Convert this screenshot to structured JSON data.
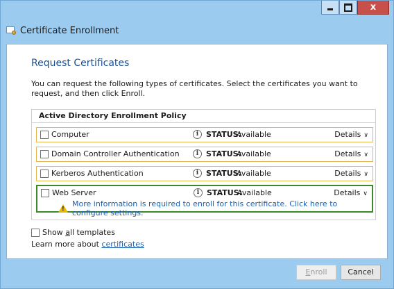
{
  "window": {
    "title": "Certificate Enrollment",
    "caption_buttons": {
      "close": "x"
    }
  },
  "page": {
    "heading": "Request Certificates",
    "intro": "You can request the following types of certificates. Select the certificates you want to request, and then click Enroll."
  },
  "policy": {
    "header": "Active Directory Enrollment Policy",
    "rows": [
      {
        "label": "Computer",
        "status_label": "STATUS:",
        "status": "Available",
        "details": "Details",
        "checked": false
      },
      {
        "label": "Domain Controller Authentication",
        "status_label": "STATUS:",
        "status": "Available",
        "details": "Details",
        "checked": false
      },
      {
        "label": "Kerberos Authentication",
        "status_label": "STATUS:",
        "status": "Available",
        "details": "Details",
        "checked": false
      },
      {
        "label": "Web Server",
        "status_label": "STATUS:",
        "status": "Available",
        "details": "Details",
        "checked": false,
        "warning": "More information is required to enroll for this certificate. Click here to configure settings."
      }
    ]
  },
  "show_all_templates": {
    "prefix": "Show ",
    "accel": "a",
    "suffix": "ll templates",
    "checked": false
  },
  "learn_more": {
    "text": "Learn more about ",
    "link": "certificates"
  },
  "footer": {
    "enroll": {
      "accel": "E",
      "rest": "nroll",
      "enabled": false
    },
    "cancel": "Cancel"
  },
  "colors": {
    "title_bar": "#9ccbf0",
    "heading": "#1f4f8f",
    "row_border": "#e6b84e",
    "selected_row_border": "#3a8a2a",
    "link": "#1a5fb4",
    "warning": "#e6b800"
  },
  "icons": {
    "window": "certificate-icon",
    "status": "info-icon",
    "warning": "warning-icon",
    "details": "chevron-down-icon"
  }
}
